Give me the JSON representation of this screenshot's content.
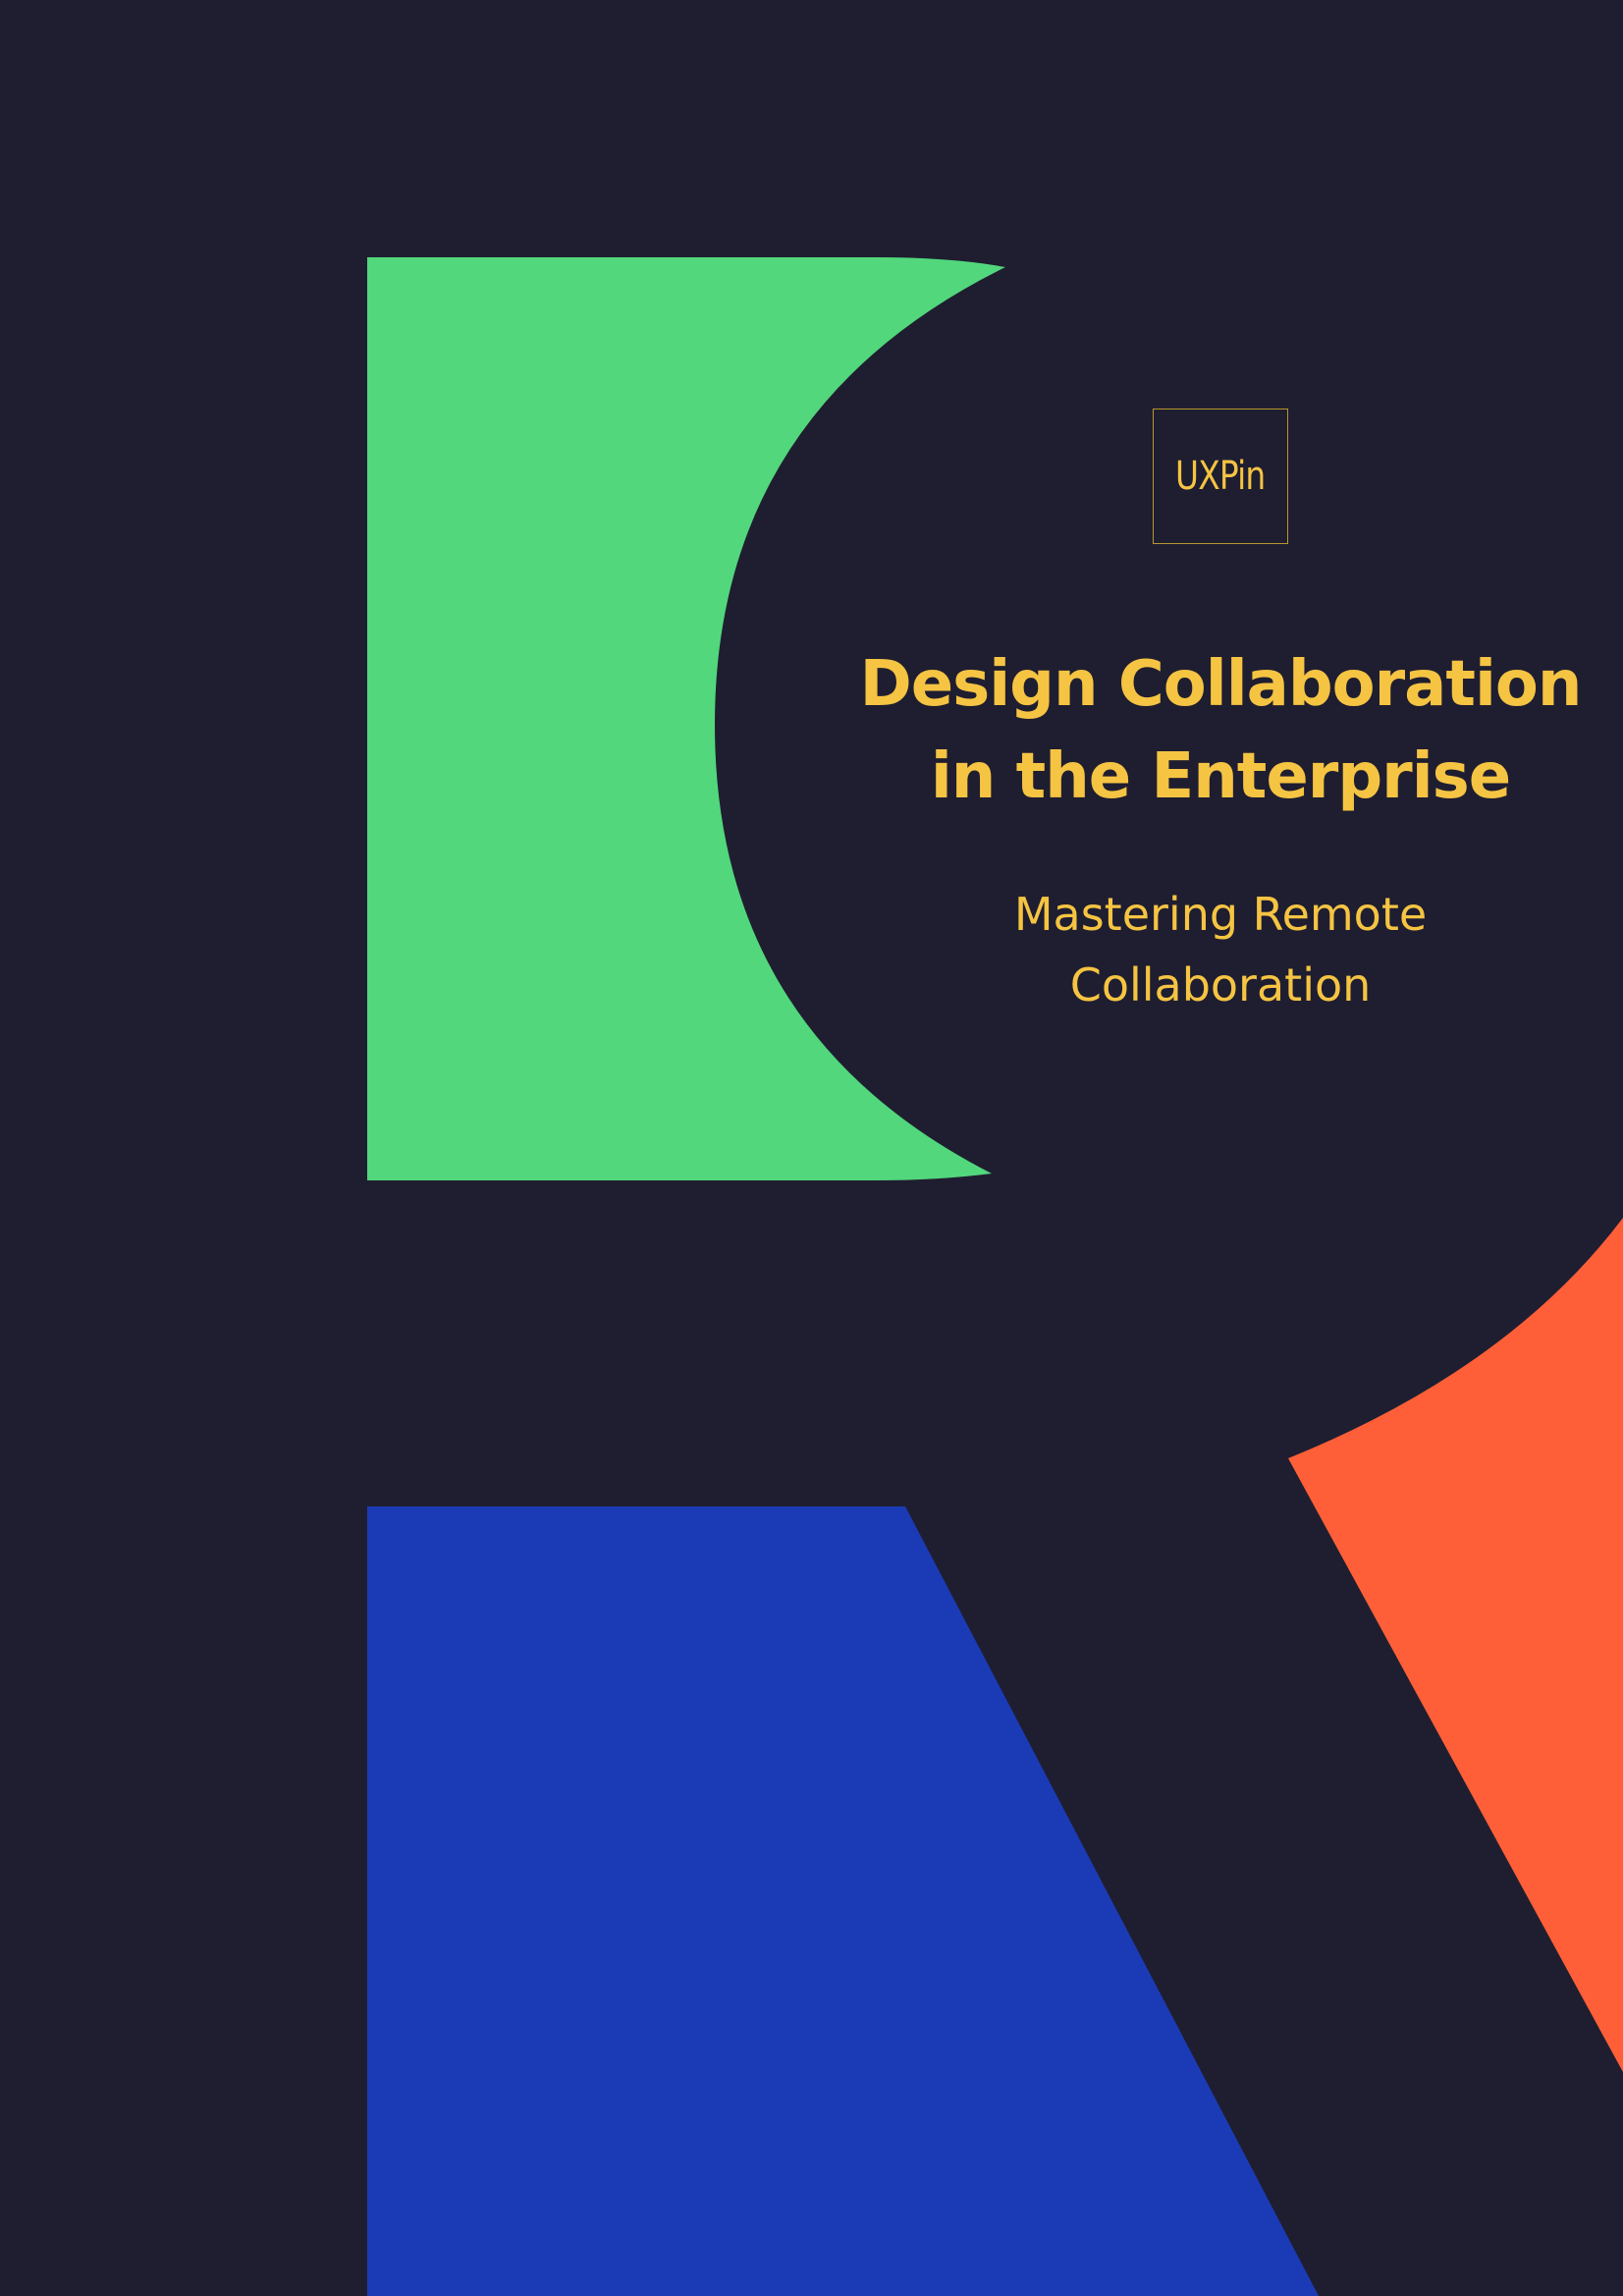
{
  "brand": {
    "logo_text": "UXPin"
  },
  "cover": {
    "title": "Design Collaboration in the Enterprise",
    "subtitle": "Mastering Remote Collaboration"
  },
  "colors": {
    "background": "#1f1e30",
    "accent_text": "#f6c443",
    "green": "#52d77c",
    "orange": "#ff5f38",
    "blue": "#1b3bb6"
  }
}
